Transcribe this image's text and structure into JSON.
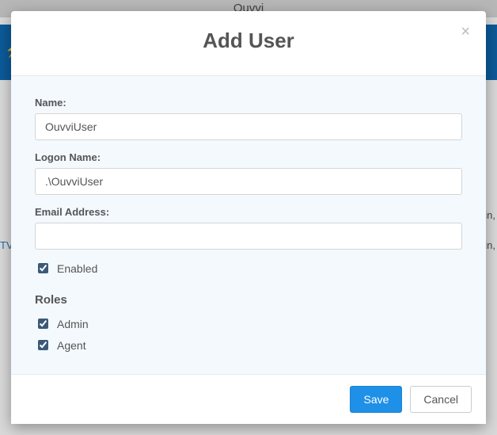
{
  "background": {
    "app_name": "Ouvvi",
    "side_hint_1": "in,",
    "side_hint_2": "in,",
    "side_hint_3": "TV"
  },
  "modal": {
    "title": "Add User",
    "close_symbol": "×",
    "body": {
      "name_label": "Name:",
      "name_value": "OuvviUser",
      "logon_label": "Logon Name:",
      "logon_value": ".\\OuvviUser",
      "email_label": "Email Address:",
      "email_value": "",
      "enabled_label": "Enabled",
      "enabled_checked": true,
      "roles_heading": "Roles",
      "roles": [
        {
          "label": "Admin",
          "checked": true
        },
        {
          "label": "Agent",
          "checked": true
        }
      ]
    },
    "footer": {
      "save_label": "Save",
      "cancel_label": "Cancel"
    }
  }
}
